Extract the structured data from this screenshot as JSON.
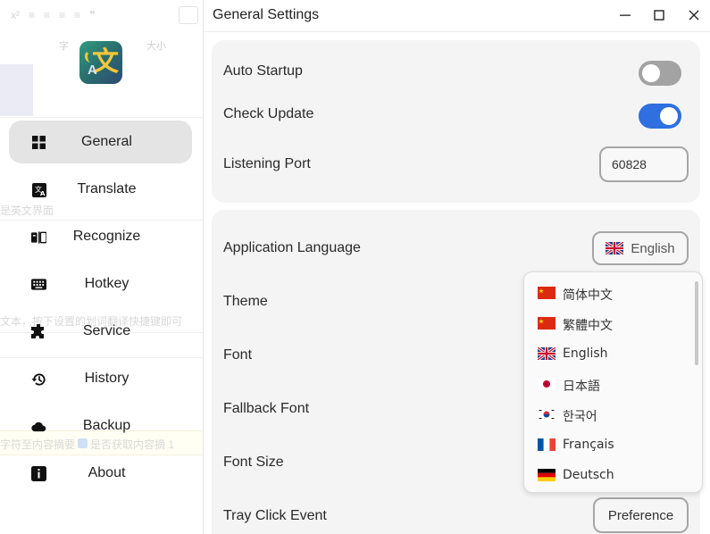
{
  "ghost": {
    "toolbar": [
      "x²",
      "≡",
      "≡",
      "≡",
      "≡",
      "❞"
    ],
    "row2": [
      "字",
      "大小"
    ],
    "text1": "是英文界面",
    "text2": "文本，按下设置的划词翻译快捷键即可",
    "text3": "字符至内容摘要",
    "text4": "是否获取内容摘 1"
  },
  "window": {
    "title": "General Settings"
  },
  "sidebar": {
    "items": [
      {
        "label": "General",
        "icon": "grid-icon",
        "active": true
      },
      {
        "label": "Translate",
        "icon": "translate-icon",
        "active": false
      },
      {
        "label": "Recognize",
        "icon": "ocr-icon",
        "active": false
      },
      {
        "label": "Hotkey",
        "icon": "keyboard-icon",
        "active": false
      },
      {
        "label": "Service",
        "icon": "puzzle-icon",
        "active": false
      },
      {
        "label": "History",
        "icon": "history-icon",
        "active": false
      },
      {
        "label": "Backup",
        "icon": "cloud-icon",
        "active": false
      },
      {
        "label": "About",
        "icon": "info-icon",
        "active": false
      }
    ]
  },
  "general": {
    "auto_startup": {
      "label": "Auto Startup",
      "enabled": false
    },
    "check_update": {
      "label": "Check Update",
      "enabled": true
    },
    "listening_port": {
      "label": "Listening Port",
      "value": "60828"
    },
    "app_language": {
      "label": "Application Language",
      "value": "English"
    },
    "theme": {
      "label": "Theme"
    },
    "font": {
      "label": "Font"
    },
    "fallback_font": {
      "label": "Fallback Font"
    },
    "font_size": {
      "label": "Font Size"
    },
    "tray_click_event": {
      "label": "Tray Click Event",
      "value": "Preference"
    }
  },
  "language_dropdown": {
    "options": [
      {
        "label": "简体中文",
        "flag": "cn"
      },
      {
        "label": "繁體中文",
        "flag": "cn"
      },
      {
        "label": "English",
        "flag": "gb"
      },
      {
        "label": "日本語",
        "flag": "jp"
      },
      {
        "label": "한국어",
        "flag": "kr"
      },
      {
        "label": "Français",
        "flag": "fr"
      },
      {
        "label": "Deutsch",
        "flag": "de"
      }
    ]
  },
  "colors": {
    "accent": "#2f6fe0",
    "toggle_off": "#a3a3a3",
    "active_nav": "#e4e4e4",
    "card_bg": "#f4f4f4"
  }
}
